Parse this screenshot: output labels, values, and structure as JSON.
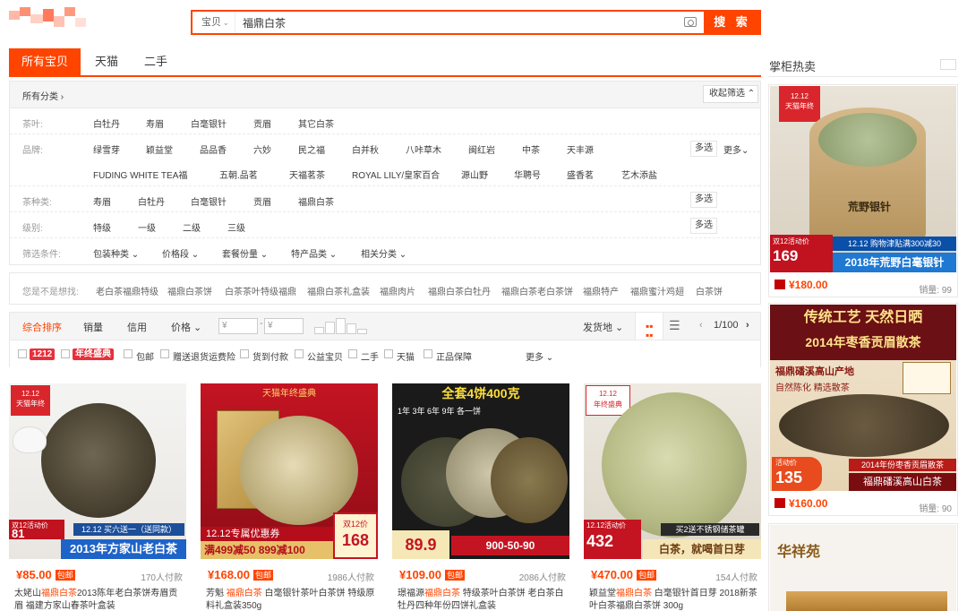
{
  "search": {
    "category": "宝贝",
    "query": "福鼎白茶",
    "button": "搜 索"
  },
  "tabs": [
    "所有宝贝",
    "天猫",
    "二手"
  ],
  "filter": {
    "all_categories": "所有分类",
    "collapse": "收起筛选",
    "rows": [
      {
        "label": "茶叶:",
        "items": [
          "白牡丹",
          "寿眉",
          "白毫银针",
          "贡眉",
          "其它白茶"
        ]
      },
      {
        "label": "品牌:",
        "items": [
          "绿雪芽",
          "颖益堂",
          "品品香",
          "六妙",
          "民之福",
          "白并秋",
          "八咔草木",
          "闽红岩",
          "中茶",
          "天丰源"
        ],
        "items2": [
          "FUDING WHITE TEA福",
          "五朝.品茗",
          "天福茗茶",
          "ROYAL LILY/皇家百合",
          "源山野",
          "华聘号",
          "盛香茗",
          "艺木添盐"
        ],
        "multi": "多选",
        "more": "更多"
      },
      {
        "label": "茶种类:",
        "items": [
          "寿眉",
          "白牡丹",
          "白毫银针",
          "贡眉",
          "福鼎白茶"
        ],
        "multi": "多选"
      },
      {
        "label": "级别:",
        "items": [
          "特级",
          "一级",
          "二级",
          "三级"
        ],
        "multi": "多选"
      },
      {
        "label": "筛选条件:",
        "items": [
          "包装种类",
          "价格段",
          "套餐份量",
          "特产品类",
          "相关分类"
        ]
      }
    ]
  },
  "related": {
    "label": "您是不是想找:",
    "items": [
      "老白茶福鼎特级",
      "福鼎白茶饼",
      "白茶茶叶特级福鼎",
      "福鼎白茶礼盒装",
      "福鼎肉片",
      "福鼎白茶白牡丹",
      "福鼎白茶老白茶饼",
      "福鼎特产",
      "福鼎蜜汁鸡翅",
      "白茶饼"
    ]
  },
  "sort": {
    "options": [
      "综合排序",
      "销量",
      "信用",
      "价格"
    ],
    "price_from": "¥",
    "price_to": "¥",
    "ship_from": "发货地",
    "page": "1/100",
    "page_current": "1",
    "checks": [
      "包邮",
      "赠送退货运费险",
      "货到付款",
      "公益宝贝",
      "二手",
      "天猫",
      "正品保障"
    ],
    "badge_1212": "1212",
    "badge_year": "年终盛典",
    "more": "更多"
  },
  "products": [
    {
      "price": "¥85.00",
      "tag": "包邮",
      "paid": "170人付款",
      "title_pre": "太姥山",
      "title_hl": "福鼎白茶",
      "title_post": "2013陈年老白茶饼寿眉贡眉 福建方家山春茶叶盒装",
      "promo": "双12活动价",
      "promo_price": "81",
      "banner": "2013年方家山老白茶",
      "buy_tag": "12.12 买六送一（送同款）"
    },
    {
      "price": "¥168.00",
      "tag": "包邮",
      "paid": "1986人付款",
      "title_pre": "芳魁 ",
      "title_hl": "福鼎白茶",
      "title_post": " 白毫银针茶叶白茶饼 特级原料礼盒装350g",
      "promo": "12.12专属优惠券",
      "promo_price": "168",
      "banner": "满499减50 899减100",
      "buy_tag": "双12价",
      "store_tag": "天猫年终盛典"
    },
    {
      "price": "¥109.00",
      "tag": "包邮",
      "paid": "2086人付款",
      "title_pre": "璟福源",
      "title_hl": "福鼎白茶",
      "title_post": " 特级茶叶白茶饼 老白茶白牡丹四种年份四饼礼盒装",
      "promo": "全套4饼400克",
      "promo_price": "89.9",
      "banner": "1年 3年 6年 9年 各一饼",
      "buy_tag": "900-50-90"
    },
    {
      "price": "¥470.00",
      "tag": "包邮",
      "paid": "154人付款",
      "title_pre": "颖益堂",
      "title_hl": "福鼎白茶",
      "title_post": " 白毫银针首日芽 2018新茶叶白茶福鼎白茶饼 300g",
      "promo": "12.12活动价",
      "promo_price": "432",
      "banner": "白茶，就喝首日芽",
      "buy_tag": "买2送不锈钢储茶罐"
    }
  ],
  "right": {
    "title": "掌柜热卖",
    "cards": [
      {
        "price": "¥180.00",
        "sales": "销量: 99",
        "promo": "双12活动价",
        "promo_price": "169",
        "banner": "2018年荒野白毫银针",
        "top_tag": "12.12 购物津贴满300减30",
        "jar_text": "荒野银针"
      },
      {
        "price": "¥160.00",
        "sales": "销量: 90",
        "head1": "传统工艺  天然日晒",
        "head2": "2014年枣香贡眉散茶",
        "sub1": "福鼎磻溪高山产地",
        "sub2": "自然陈化  精选散茶",
        "promo": "活动价",
        "promo_price": "135",
        "tag": "2014年份枣香贡眉散茶",
        "banner": "福鼎磻溪高山白茶"
      },
      {
        "brand": "华祥苑"
      }
    ]
  },
  "colors": {
    "accent": "#ff4400",
    "tmall": "#c40000"
  }
}
